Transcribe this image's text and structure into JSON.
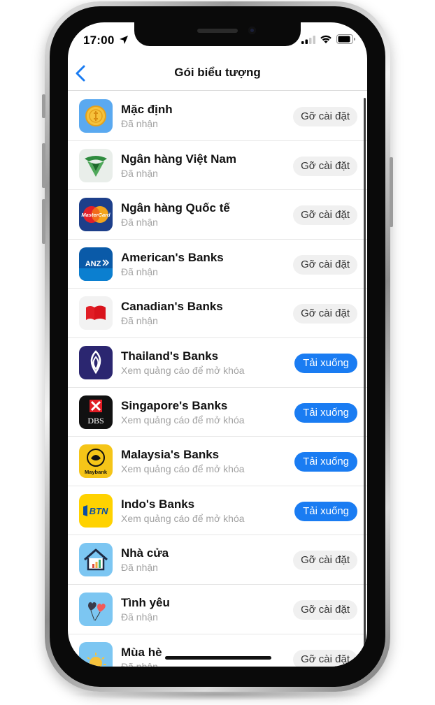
{
  "status": {
    "time": "17:00"
  },
  "nav": {
    "title": "Gói biểu tượng"
  },
  "items": [
    {
      "title": "Mặc định",
      "subtitle": "Đã nhận",
      "action": "Gỡ cài đặt",
      "action_type": "uninstall",
      "icon": "coin-icon"
    },
    {
      "title": "Ngân hàng Việt Nam",
      "subtitle": "Đã nhận",
      "action": "Gỡ cài đặt",
      "action_type": "uninstall",
      "icon": "vietcombank-icon"
    },
    {
      "title": "Ngân hàng Quốc tế",
      "subtitle": "Đã nhận",
      "action": "Gỡ cài đặt",
      "action_type": "uninstall",
      "icon": "mastercard-icon"
    },
    {
      "title": "American's Banks",
      "subtitle": "Đã nhận",
      "action": "Gỡ cài đặt",
      "action_type": "uninstall",
      "icon": "anz-icon"
    },
    {
      "title": "Canadian's Banks",
      "subtitle": "Đã nhận",
      "action": "Gỡ cài đặt",
      "action_type": "uninstall",
      "icon": "canada-flag-icon"
    },
    {
      "title": "Thailand's Banks",
      "subtitle": "Xem quảng cáo để mở khóa",
      "action": "Tải xuống",
      "action_type": "download",
      "icon": "scb-icon"
    },
    {
      "title": "Singapore's Banks",
      "subtitle": "Xem quảng cáo để mở khóa",
      "action": "Tải xuống",
      "action_type": "download",
      "icon": "dbs-icon"
    },
    {
      "title": "Malaysia's Banks",
      "subtitle": "Xem quảng cáo để mở khóa",
      "action": "Tải xuống",
      "action_type": "download",
      "icon": "maybank-icon"
    },
    {
      "title": "Indo's Banks",
      "subtitle": "Xem quảng cáo để mở khóa",
      "action": "Tải xuống",
      "action_type": "download",
      "icon": "btn-icon"
    },
    {
      "title": "Nhà cửa",
      "subtitle": "Đã nhận",
      "action": "Gỡ cài đặt",
      "action_type": "uninstall",
      "icon": "house-icon"
    },
    {
      "title": "Tình yêu",
      "subtitle": "Đã nhận",
      "action": "Gỡ cài đặt",
      "action_type": "uninstall",
      "icon": "balloons-icon"
    },
    {
      "title": "Mùa hè",
      "subtitle": "Đã nhận",
      "action": "Gỡ cài đặt",
      "action_type": "uninstall",
      "icon": "sun-icon"
    }
  ],
  "icon_logos": {
    "dbs": "DBS",
    "maybank": "Maybank",
    "btn": "BTN",
    "mastercard": "MasterCard",
    "anz": "ANZ"
  },
  "colors": {
    "accent": "#1a7cf2",
    "download_button": "#1a7cf2",
    "uninstall_button": "#f0f0f0"
  }
}
